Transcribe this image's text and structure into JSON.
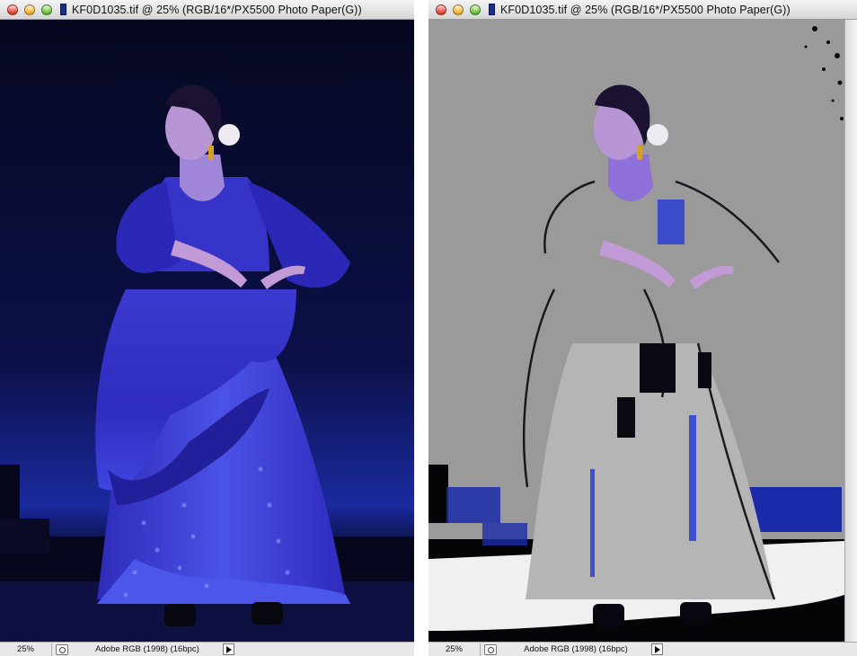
{
  "windows": [
    {
      "title": "KF0D1035.tif @ 25% (RGB/16*/PX5500 Photo Paper(G))",
      "zoom": "25%",
      "profile": "Adobe RGB (1998) (16bpc)",
      "view": "normal"
    },
    {
      "title": "KF0D1035.tif @ 25% (RGB/16*/PX5500 Photo Paper(G))",
      "zoom": "25%",
      "profile": "Adobe RGB (1998) (16bpc)",
      "view": "gamut-warning"
    }
  ],
  "colors": {
    "stage_dark": "#07092a",
    "dress_blue": "#3533c8",
    "gamut_gray": "#9a9a9a",
    "skin": "#c7a3d8"
  },
  "icons": {
    "close": "close-icon",
    "minimize": "minimize-icon",
    "zoom": "zoom-icon",
    "document": "document-proxy-icon",
    "status": "status-info-icon",
    "menu": "status-menu-arrow-icon"
  }
}
